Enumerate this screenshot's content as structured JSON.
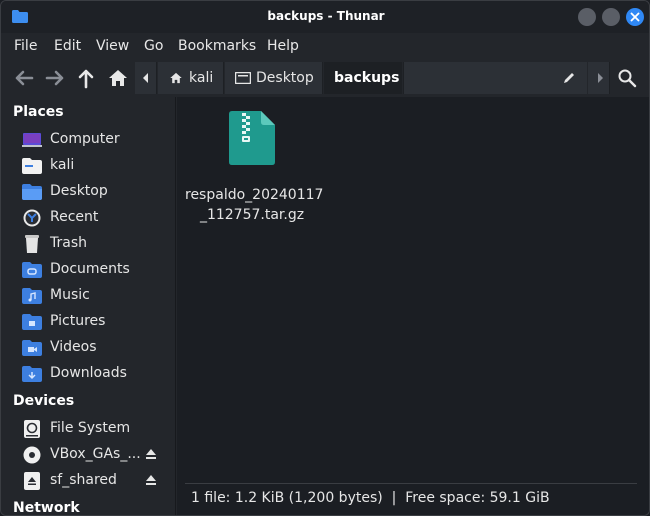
{
  "window": {
    "title": "backups - Thunar"
  },
  "menubar": [
    "File",
    "Edit",
    "View",
    "Go",
    "Bookmarks",
    "Help"
  ],
  "pathbar": {
    "segments": [
      {
        "label": "kali",
        "icon": "home-icon"
      },
      {
        "label": "Desktop",
        "icon": "desktop-icon"
      },
      {
        "label": "backups",
        "icon": "",
        "active": true
      }
    ]
  },
  "sidebar": {
    "places_header": "Places",
    "places": [
      {
        "label": "Computer",
        "icon": "computer-icon"
      },
      {
        "label": "kali",
        "icon": "home-folder-icon"
      },
      {
        "label": "Desktop",
        "icon": "desktop-folder-icon"
      },
      {
        "label": "Recent",
        "icon": "recent-icon"
      },
      {
        "label": "Trash",
        "icon": "trash-icon"
      },
      {
        "label": "Documents",
        "icon": "documents-folder-icon"
      },
      {
        "label": "Music",
        "icon": "music-folder-icon"
      },
      {
        "label": "Pictures",
        "icon": "pictures-folder-icon"
      },
      {
        "label": "Videos",
        "icon": "videos-folder-icon"
      },
      {
        "label": "Downloads",
        "icon": "downloads-folder-icon"
      }
    ],
    "devices_header": "Devices",
    "devices": [
      {
        "label": "File System",
        "icon": "drive-icon"
      },
      {
        "label": "VBox_GAs_...",
        "icon": "optical-disc-icon",
        "eject": true
      },
      {
        "label": "sf_shared",
        "icon": "removable-drive-icon",
        "eject": true
      }
    ],
    "network_header": "Network"
  },
  "files": [
    {
      "name_line1": "respaldo_20240117",
      "name_line2": "_112757.tar.gz",
      "icon": "archive-icon"
    }
  ],
  "statusbar": {
    "text": "1 file: 1.2 KiB (1,200 bytes)  |  Free space: 59.1 GiB"
  },
  "colors": {
    "accent": "#2f88f5",
    "folder": "#3d7fe0",
    "archive": "#1f9a8e"
  }
}
